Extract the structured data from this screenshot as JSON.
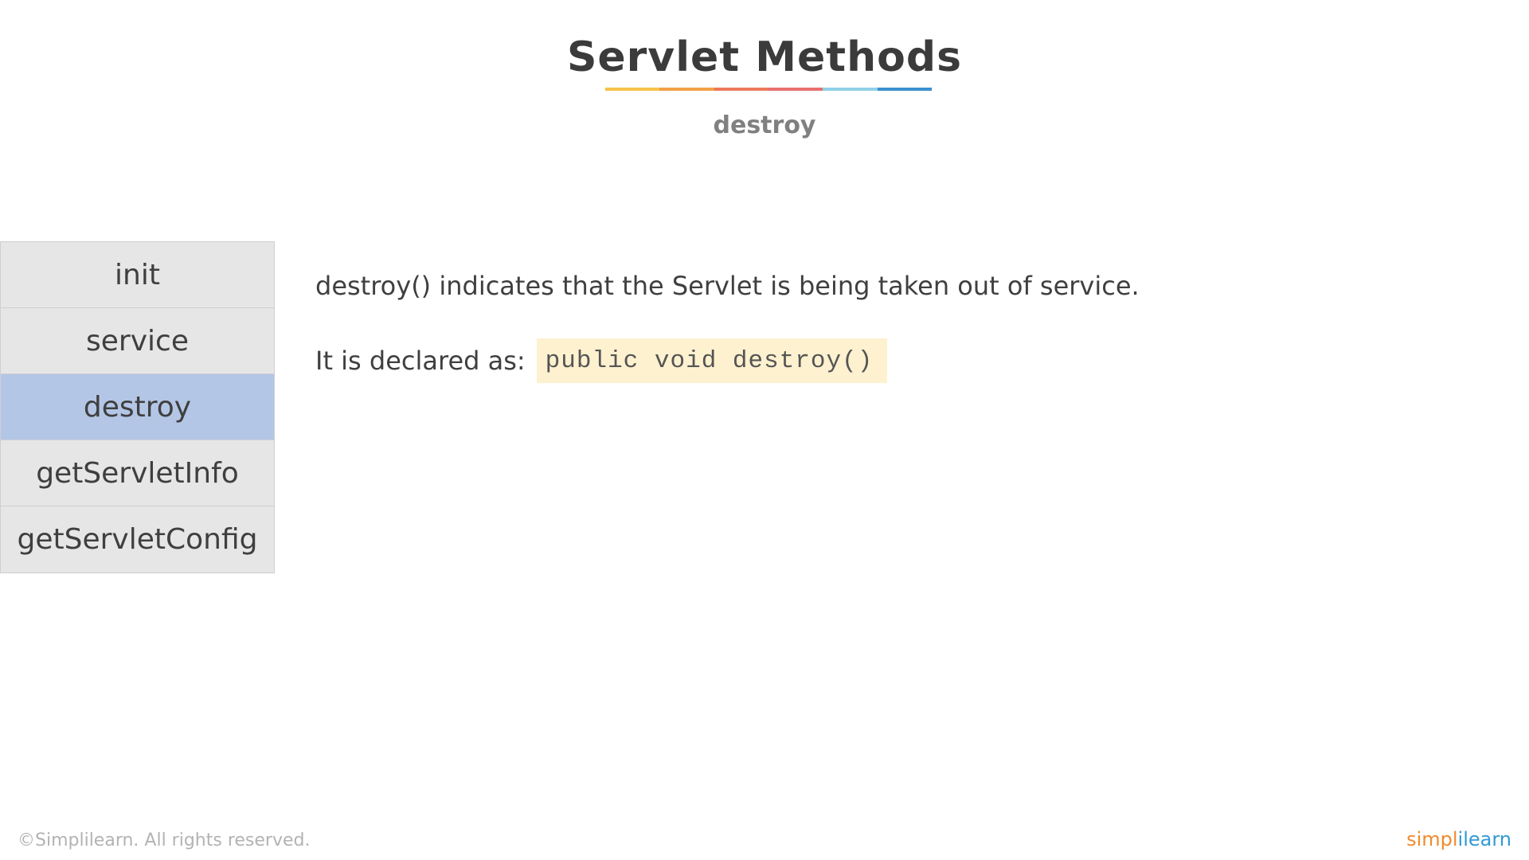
{
  "slide": {
    "title": "Servlet Methods",
    "subtitle": "destroy",
    "underline_colors": [
      "#f6c34a",
      "#f3a046",
      "#ec7a5a",
      "#e96e6e",
      "#8fd0e6",
      "#3b8fd0"
    ]
  },
  "menu": {
    "items": [
      {
        "label": "init",
        "active": false
      },
      {
        "label": "service",
        "active": false
      },
      {
        "label": "destroy",
        "active": true
      },
      {
        "label": "getServletInfo",
        "active": false
      },
      {
        "label": "getServletConfig",
        "active": false
      }
    ]
  },
  "content": {
    "description": "destroy() indicates that the Servlet is being taken out of service.",
    "declared_label": "It is declared as:",
    "declaration_code": "public void destroy()"
  },
  "footer": {
    "copyright": "©Simplilearn. All rights reserved.",
    "logo_part1": "simpl",
    "logo_part2": "ilearn"
  },
  "colors": {
    "active_item": "#b3c6e6",
    "inactive_item": "#e6e6e6",
    "code_background": "#fdf1cf"
  }
}
